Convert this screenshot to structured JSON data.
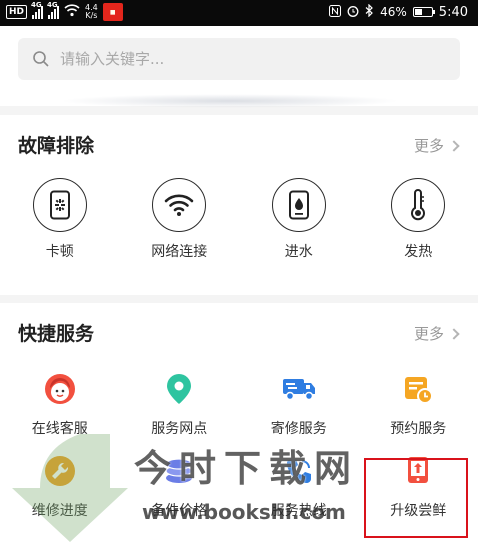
{
  "status_bar": {
    "network_left": "HD",
    "signal_1": "4G",
    "signal_2": "4G",
    "speed_value": "4.4",
    "speed_unit": "K/s",
    "battery": "46%",
    "battery_level": 0.46,
    "time": "5:40"
  },
  "search": {
    "placeholder": "请输入关键字..."
  },
  "troubleshoot": {
    "title": "故障排除",
    "more": "更多",
    "items": [
      {
        "label": "卡顿",
        "icon": "phone-lag-icon"
      },
      {
        "label": "网络连接",
        "icon": "wifi-icon"
      },
      {
        "label": "进水",
        "icon": "phone-water-icon"
      },
      {
        "label": "发热",
        "icon": "thermometer-icon"
      }
    ]
  },
  "quick_services": {
    "title": "快捷服务",
    "more": "更多",
    "items": [
      {
        "label": "在线客服",
        "icon": "customer-service-icon",
        "color": "#f2503f"
      },
      {
        "label": "服务网点",
        "icon": "location-pin-icon",
        "color": "#2ec4a0"
      },
      {
        "label": "寄修服务",
        "icon": "delivery-truck-icon",
        "color": "#2f7de1"
      },
      {
        "label": "预约服务",
        "icon": "calendar-clock-icon",
        "color": "#f5a623"
      },
      {
        "label": "维修进度",
        "icon": "wrench-progress-icon",
        "color": "#f0a020"
      },
      {
        "label": "备件价格",
        "icon": "coins-icon",
        "color": "#6b7de6"
      },
      {
        "label": "服务热线",
        "icon": "phone-call-icon",
        "color": "#2f7de1"
      },
      {
        "label": "升级尝鲜",
        "icon": "upgrade-icon",
        "color": "#f2503f"
      }
    ]
  },
  "watermark": {
    "site_cn": "今时下载网",
    "site_url": "www.bookshi.com"
  }
}
